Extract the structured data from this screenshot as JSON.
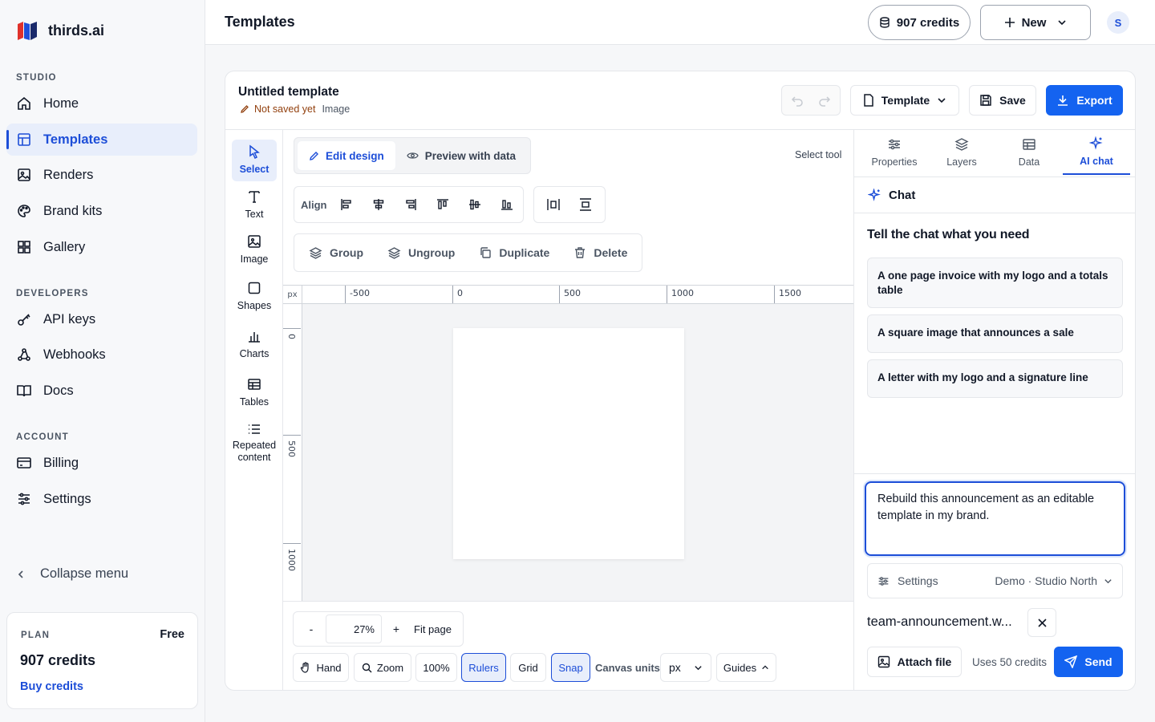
{
  "app": {
    "name": "thirds.ai"
  },
  "sidebar": {
    "sections": {
      "studio": "STUDIO",
      "developers": "DEVELOPERS",
      "account": "ACCOUNT"
    },
    "studio_items": [
      {
        "label": "Home",
        "icon": "home-icon"
      },
      {
        "label": "Templates",
        "icon": "templates-icon",
        "active": true
      },
      {
        "label": "Renders",
        "icon": "image-icon"
      },
      {
        "label": "Brand kits",
        "icon": "palette-icon"
      },
      {
        "label": "Gallery",
        "icon": "grid-icon"
      }
    ],
    "developer_items": [
      {
        "label": "API keys",
        "icon": "key-icon"
      },
      {
        "label": "Webhooks",
        "icon": "webhook-icon"
      },
      {
        "label": "Docs",
        "icon": "book-icon"
      }
    ],
    "account_items": [
      {
        "label": "Billing",
        "icon": "credit-card-icon"
      },
      {
        "label": "Settings",
        "icon": "sliders-icon"
      }
    ],
    "collapse_label": "Collapse menu",
    "plan": {
      "label": "PLAN",
      "tier": "Free",
      "credits": "907 credits",
      "buy_label": "Buy credits"
    }
  },
  "header": {
    "title": "Templates",
    "credits_label": "907 credits",
    "new_label": "New",
    "avatar_initial": "S"
  },
  "editor": {
    "template_title": "Untitled template",
    "save_status": "Not saved yet",
    "template_type": "Image",
    "template_dropdown_label": "Template",
    "save_label": "Save",
    "export_label": "Export",
    "tools": [
      {
        "label": "Select",
        "icon": "cursor-icon",
        "active": true
      },
      {
        "label": "Text",
        "icon": "text-icon"
      },
      {
        "label": "Image",
        "icon": "image-icon"
      },
      {
        "label": "Shapes",
        "icon": "square-icon"
      },
      {
        "label": "Charts",
        "icon": "bar-chart-icon"
      },
      {
        "label": "Tables",
        "icon": "table-icon"
      },
      {
        "label": "Repeated content",
        "icon": "list-icon"
      }
    ],
    "mode_tabs": {
      "edit": "Edit design",
      "preview": "Preview with data"
    },
    "current_tool_label": "Select tool",
    "align_label": "Align",
    "actions": {
      "group": "Group",
      "ungroup": "Ungroup",
      "duplicate": "Duplicate",
      "delete": "Delete"
    },
    "ruler": {
      "unit": "px",
      "h_ticks": [
        "-500",
        "0",
        "500",
        "1000",
        "1500"
      ],
      "v_ticks": [
        "0",
        "500",
        "1000"
      ]
    },
    "zoom": {
      "minus": "-",
      "value": "27%",
      "plus": "+",
      "fit_label": "Fit page"
    },
    "bottom_controls": {
      "hand": "Hand",
      "zoom": "Zoom",
      "zoom_100": "100%",
      "rulers": "Rulers",
      "grid": "Grid",
      "snap": "Snap",
      "canvas_units_label": "Canvas units",
      "canvas_units_value": "px",
      "guides": "Guides"
    }
  },
  "right_panel": {
    "tabs": [
      {
        "label": "Properties",
        "icon": "sliders-icon"
      },
      {
        "label": "Layers",
        "icon": "layers-icon"
      },
      {
        "label": "Data",
        "icon": "table-icon"
      },
      {
        "label": "AI chat",
        "icon": "sparkle-icon",
        "active": true
      }
    ],
    "chat_title": "Chat",
    "prompt_heading": "Tell the chat what you need",
    "suggestions": [
      "A one page invoice with my logo and a totals table",
      "A square image that announces a sale",
      "A letter with my logo and a signature line"
    ],
    "compose_text": "Rebuild this announcement as an editable template in my brand.",
    "settings_label": "Settings",
    "settings_value": "Demo · Studio North",
    "attached_file": "team-announcement.w...",
    "attach_label": "Attach file",
    "uses_label": "Uses 50 credits",
    "send_label": "Send"
  },
  "colors": {
    "accent": "#1463f0",
    "accent_text": "#1d4ed8",
    "active_bg": "#e8eefb"
  }
}
